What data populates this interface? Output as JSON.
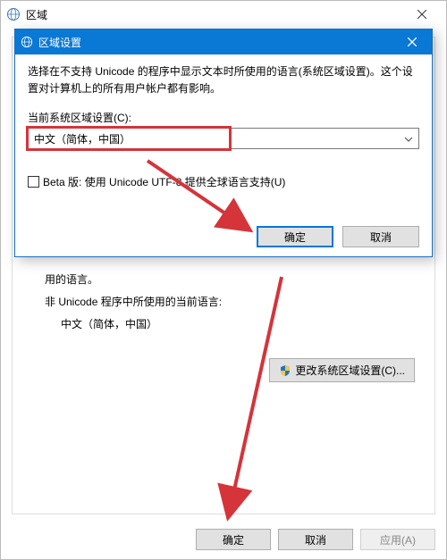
{
  "outer": {
    "title": "区域",
    "body_text_trunc": "用的语言。",
    "section_label": "非 Unicode 程序中所使用的当前语言:",
    "current_lang": "中文（简体，中国）",
    "change_btn": "更改系统区域设置(C)...",
    "ok": "确定",
    "cancel": "取消",
    "apply": "应用(A)"
  },
  "modal": {
    "title": "区域设置",
    "desc": "选择在不支持 Unicode 的程序中显示文本时所使用的语言(系统区域设置)。这个设置对计算机上的所有用户帐户都有影响。",
    "combo_label": "当前系统区域设置(C):",
    "combo_value": "中文（简体，中国）",
    "beta_label": "Beta 版: 使用 Unicode UTF-8 提供全球语言支持(U)",
    "ok": "确定",
    "cancel": "取消"
  }
}
